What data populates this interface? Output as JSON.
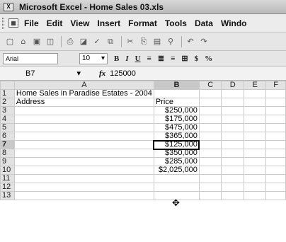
{
  "window": {
    "app_icon": "X",
    "title": "Microsoft Excel - Home Sales 03.xls"
  },
  "menubar": {
    "items": [
      "File",
      "Edit",
      "View",
      "Insert",
      "Format",
      "Tools",
      "Data",
      "Windo"
    ]
  },
  "toolbar_icons": [
    "new-icon",
    "open-icon",
    "save-icon",
    "permission-icon",
    "print-icon",
    "print-preview-icon",
    "spelling-icon",
    "research-icon",
    "cut-icon",
    "copy-icon",
    "paste-icon",
    "format-painter-icon",
    "undo-icon",
    "redo-icon"
  ],
  "formatting": {
    "font": "Arial",
    "size": "10",
    "bold": "B",
    "italic": "I",
    "underline": "U",
    "currency": "$",
    "percent": "%"
  },
  "formula_bar": {
    "name_box": "B7",
    "fx": "fx",
    "value": "125000"
  },
  "grid": {
    "columns": [
      "A",
      "B",
      "C",
      "D",
      "E",
      "F"
    ],
    "rows": [
      {
        "num": "1",
        "cells": [
          "Home Sales in Paradise Estates - 2004",
          "",
          "",
          "",
          "",
          ""
        ]
      },
      {
        "num": "2",
        "cells": [
          "Address",
          "Price",
          "",
          "",
          "",
          ""
        ]
      },
      {
        "num": "3",
        "cells": [
          "",
          "$250,000",
          "",
          "",
          "",
          ""
        ]
      },
      {
        "num": "4",
        "cells": [
          "",
          "$175,000",
          "",
          "",
          "",
          ""
        ]
      },
      {
        "num": "5",
        "cells": [
          "",
          "$475,000",
          "",
          "",
          "",
          ""
        ]
      },
      {
        "num": "6",
        "cells": [
          "",
          "$365,000",
          "",
          "",
          "",
          ""
        ]
      },
      {
        "num": "7",
        "cells": [
          "",
          "$125,000",
          "",
          "",
          "",
          ""
        ]
      },
      {
        "num": "8",
        "cells": [
          "",
          "$350,000",
          "",
          "",
          "",
          ""
        ]
      },
      {
        "num": "9",
        "cells": [
          "",
          "$285,000",
          "",
          "",
          "",
          ""
        ]
      },
      {
        "num": "10",
        "cells": [
          "",
          "$2,025,000",
          "",
          "",
          "",
          ""
        ]
      },
      {
        "num": "11",
        "cells": [
          "",
          "",
          "",
          "",
          "",
          ""
        ]
      },
      {
        "num": "12",
        "cells": [
          "",
          "",
          "",
          "",
          "",
          ""
        ]
      },
      {
        "num": "13",
        "cells": [
          "",
          "",
          "",
          "",
          "",
          ""
        ]
      }
    ]
  },
  "cursor_glyph": "✥"
}
